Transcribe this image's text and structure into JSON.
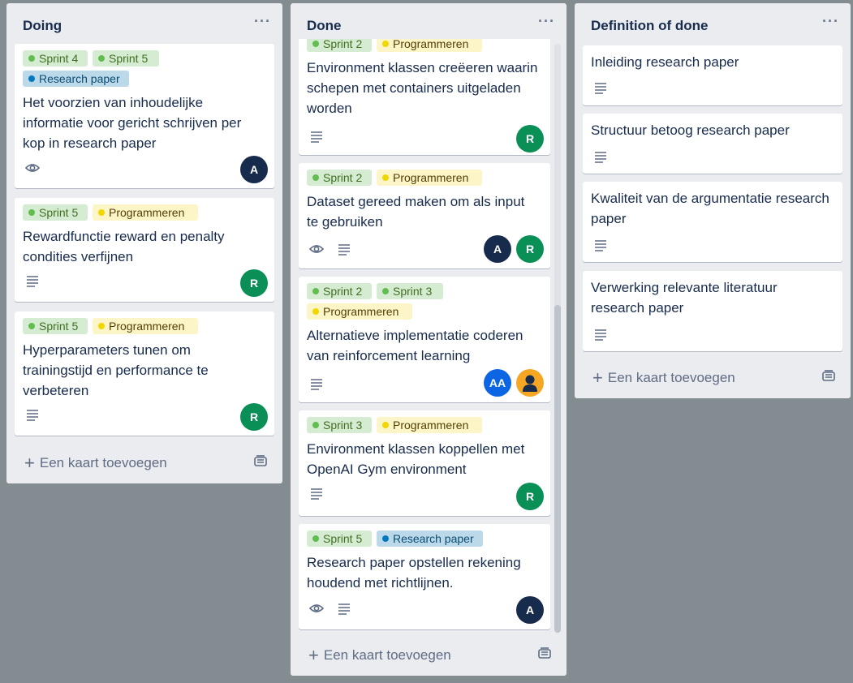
{
  "lists": [
    {
      "title": "Doing",
      "menu": "···",
      "add_card": "Een kaart toevoegen",
      "cards": [
        {
          "labels": [
            "Sprint 4",
            "Sprint 5",
            "Research paper"
          ],
          "title": "Het voorzien van inhoudelijke informatie voor gericht schrijven per kop in research paper",
          "badges": [
            "eye-icon"
          ],
          "avatars": [
            "A"
          ]
        },
        {
          "labels": [
            "Sprint 5",
            "Programmeren"
          ],
          "title": "Rewardfunctie reward en penalty condities verfijnen",
          "badges": [
            "description-icon"
          ],
          "avatars": [
            "R"
          ]
        },
        {
          "labels": [
            "Sprint 5",
            "Programmeren"
          ],
          "title": "Hyperparameters tunen om trainingstijd en performance te verbeteren",
          "badges": [
            "description-icon"
          ],
          "avatars": [
            "R"
          ]
        }
      ]
    },
    {
      "title": "Done",
      "menu": "···",
      "add_card": "Een kaart toevoegen",
      "cards": [
        {
          "labels": [
            "Sprint 2",
            "Programmeren"
          ],
          "title": "Environment klassen creëeren waarin schepen met containers uitgeladen worden",
          "badges": [
            "description-icon"
          ],
          "avatars": [
            "R"
          ]
        },
        {
          "labels": [
            "Sprint 2",
            "Programmeren"
          ],
          "title": "Dataset gereed maken om als input te gebruiken",
          "badges": [
            "eye-icon",
            "description-icon"
          ],
          "avatars": [
            "A",
            "R"
          ]
        },
        {
          "labels": [
            "Sprint 2",
            "Sprint 3",
            "Programmeren"
          ],
          "title": "Alternatieve implementatie coderen van reinforcement learning",
          "badges": [
            "description-icon"
          ],
          "avatars": [
            "AA",
            "user-avatar-icon"
          ]
        },
        {
          "labels": [
            "Sprint 3",
            "Programmeren"
          ],
          "title": "Environment klassen koppellen met OpenAI Gym environment",
          "badges": [
            "description-icon"
          ],
          "avatars": [
            "R"
          ]
        },
        {
          "labels": [
            "Sprint 5",
            "Research paper"
          ],
          "title": "Research paper opstellen rekening houdend met richtlijnen.",
          "badges": [
            "eye-icon",
            "description-icon"
          ],
          "avatars": [
            "A"
          ]
        }
      ]
    },
    {
      "title": "Definition of done",
      "menu": "···",
      "add_card": "Een kaart toevoegen",
      "cards": [
        {
          "labels": [],
          "title": "Inleiding research paper",
          "badges": [
            "description-icon"
          ],
          "avatars": []
        },
        {
          "labels": [],
          "title": "Structuur betoog research paper",
          "badges": [
            "description-icon"
          ],
          "avatars": []
        },
        {
          "labels": [],
          "title": "Kwaliteit van de argumentatie research paper",
          "badges": [
            "description-icon"
          ],
          "avatars": []
        },
        {
          "labels": [],
          "title": "Verwerking relevante literatuur research paper",
          "badges": [
            "description-icon"
          ],
          "avatars": []
        }
      ]
    }
  ],
  "colors": {
    "board_background": "#838c91",
    "list_background": "#ebecf0",
    "label_green": "#61bd4f",
    "label_yellow": "#f2d600",
    "label_blue": "#0079bf",
    "avatar_navy": "#172b4d",
    "avatar_green": "#0a8f57"
  }
}
